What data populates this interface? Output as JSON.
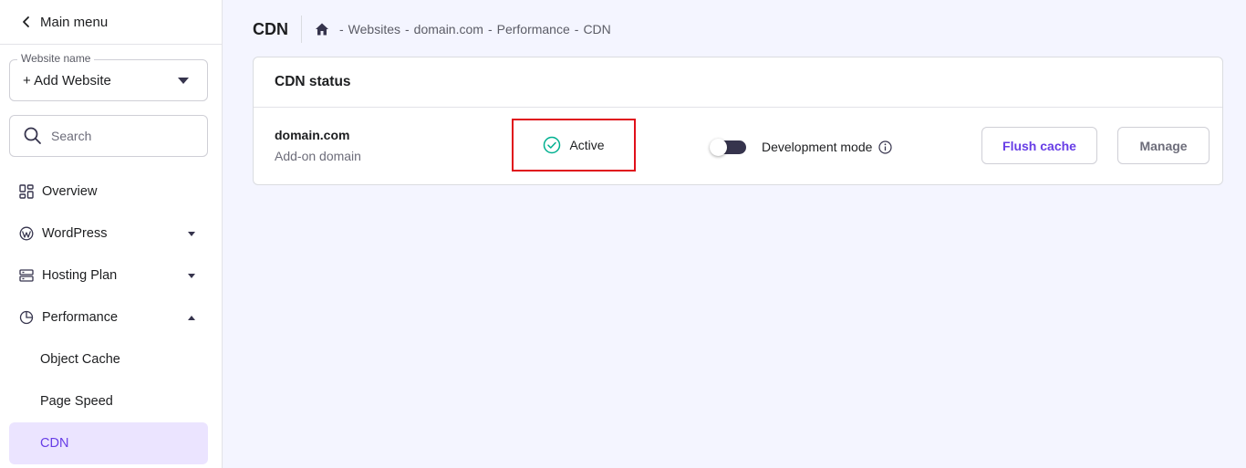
{
  "sidebar": {
    "back_label": "Main menu",
    "website_select": {
      "legend": "Website name",
      "value": "+ Add Website"
    },
    "search": {
      "placeholder": "Search"
    },
    "items": [
      {
        "label": "Overview",
        "icon": "overview-grid-icon"
      },
      {
        "label": "WordPress",
        "icon": "wordpress-icon",
        "expandable": true
      },
      {
        "label": "Hosting Plan",
        "icon": "server-icon",
        "expandable": true
      },
      {
        "label": "Performance",
        "icon": "pie-chart-icon",
        "expanded": true
      },
      {
        "label": "Object Cache",
        "sub": true
      },
      {
        "label": "Page Speed",
        "sub": true
      },
      {
        "label": "CDN",
        "sub": true,
        "active": true
      }
    ]
  },
  "header": {
    "title": "CDN",
    "breadcrumbs": [
      "Websites",
      "domain.com",
      "Performance",
      "CDN"
    ],
    "separator": "-"
  },
  "card": {
    "title": "CDN status",
    "domain": "domain.com",
    "domain_type": "Add-on domain",
    "status": "Active",
    "dev_mode_label": "Development mode",
    "dev_mode_on": false,
    "flush_label": "Flush cache",
    "manage_label": "Manage"
  },
  "colors": {
    "accent": "#673de6",
    "active_bg": "#ebe4ff",
    "status_green": "#00b090",
    "highlight_red": "#e0101a"
  }
}
